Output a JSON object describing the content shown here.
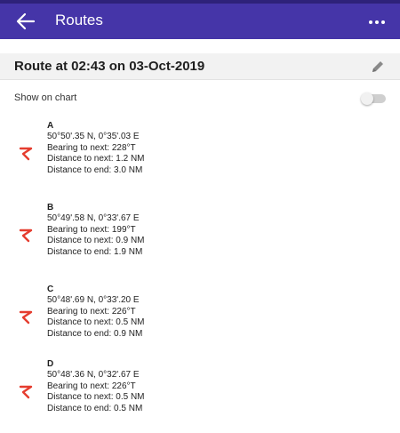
{
  "colors": {
    "appbar": "#4535a8",
    "accent_icon": "#e53d2f",
    "header_bg": "#f2f2f2"
  },
  "appbar": {
    "title": "Routes",
    "back_icon": "arrow-left-icon",
    "more_icon": "more-horizontal-icon"
  },
  "route": {
    "title": "Route at 02:43 on 03-Oct-2019",
    "edit_icon": "pencil-icon"
  },
  "show_on_chart": {
    "label": "Show on chart",
    "enabled": false
  },
  "waypoints": [
    {
      "name": "A",
      "position": "50°50'.35 N, 0°35'.03 E",
      "bearing": "Bearing to next: 228°T",
      "distance_next": "Distance to next: 1.2 NM",
      "distance_end": "Distance to end: 3.0 NM"
    },
    {
      "name": "B",
      "position": "50°49'.58 N, 0°33'.67 E",
      "bearing": "Bearing to next: 199°T",
      "distance_next": "Distance to next: 0.9 NM",
      "distance_end": "Distance to end: 1.9 NM"
    },
    {
      "name": "C",
      "position": "50°48'.69 N, 0°33'.20 E",
      "bearing": "Bearing to next: 226°T",
      "distance_next": "Distance to next: 0.5 NM",
      "distance_end": "Distance to end: 0.9 NM"
    },
    {
      "name": "D",
      "position": "50°48'.36 N, 0°32'.67 E",
      "bearing": "Bearing to next: 226°T",
      "distance_next": "Distance to next: 0.5 NM",
      "distance_end": "Distance to end: 0.5 NM"
    }
  ]
}
